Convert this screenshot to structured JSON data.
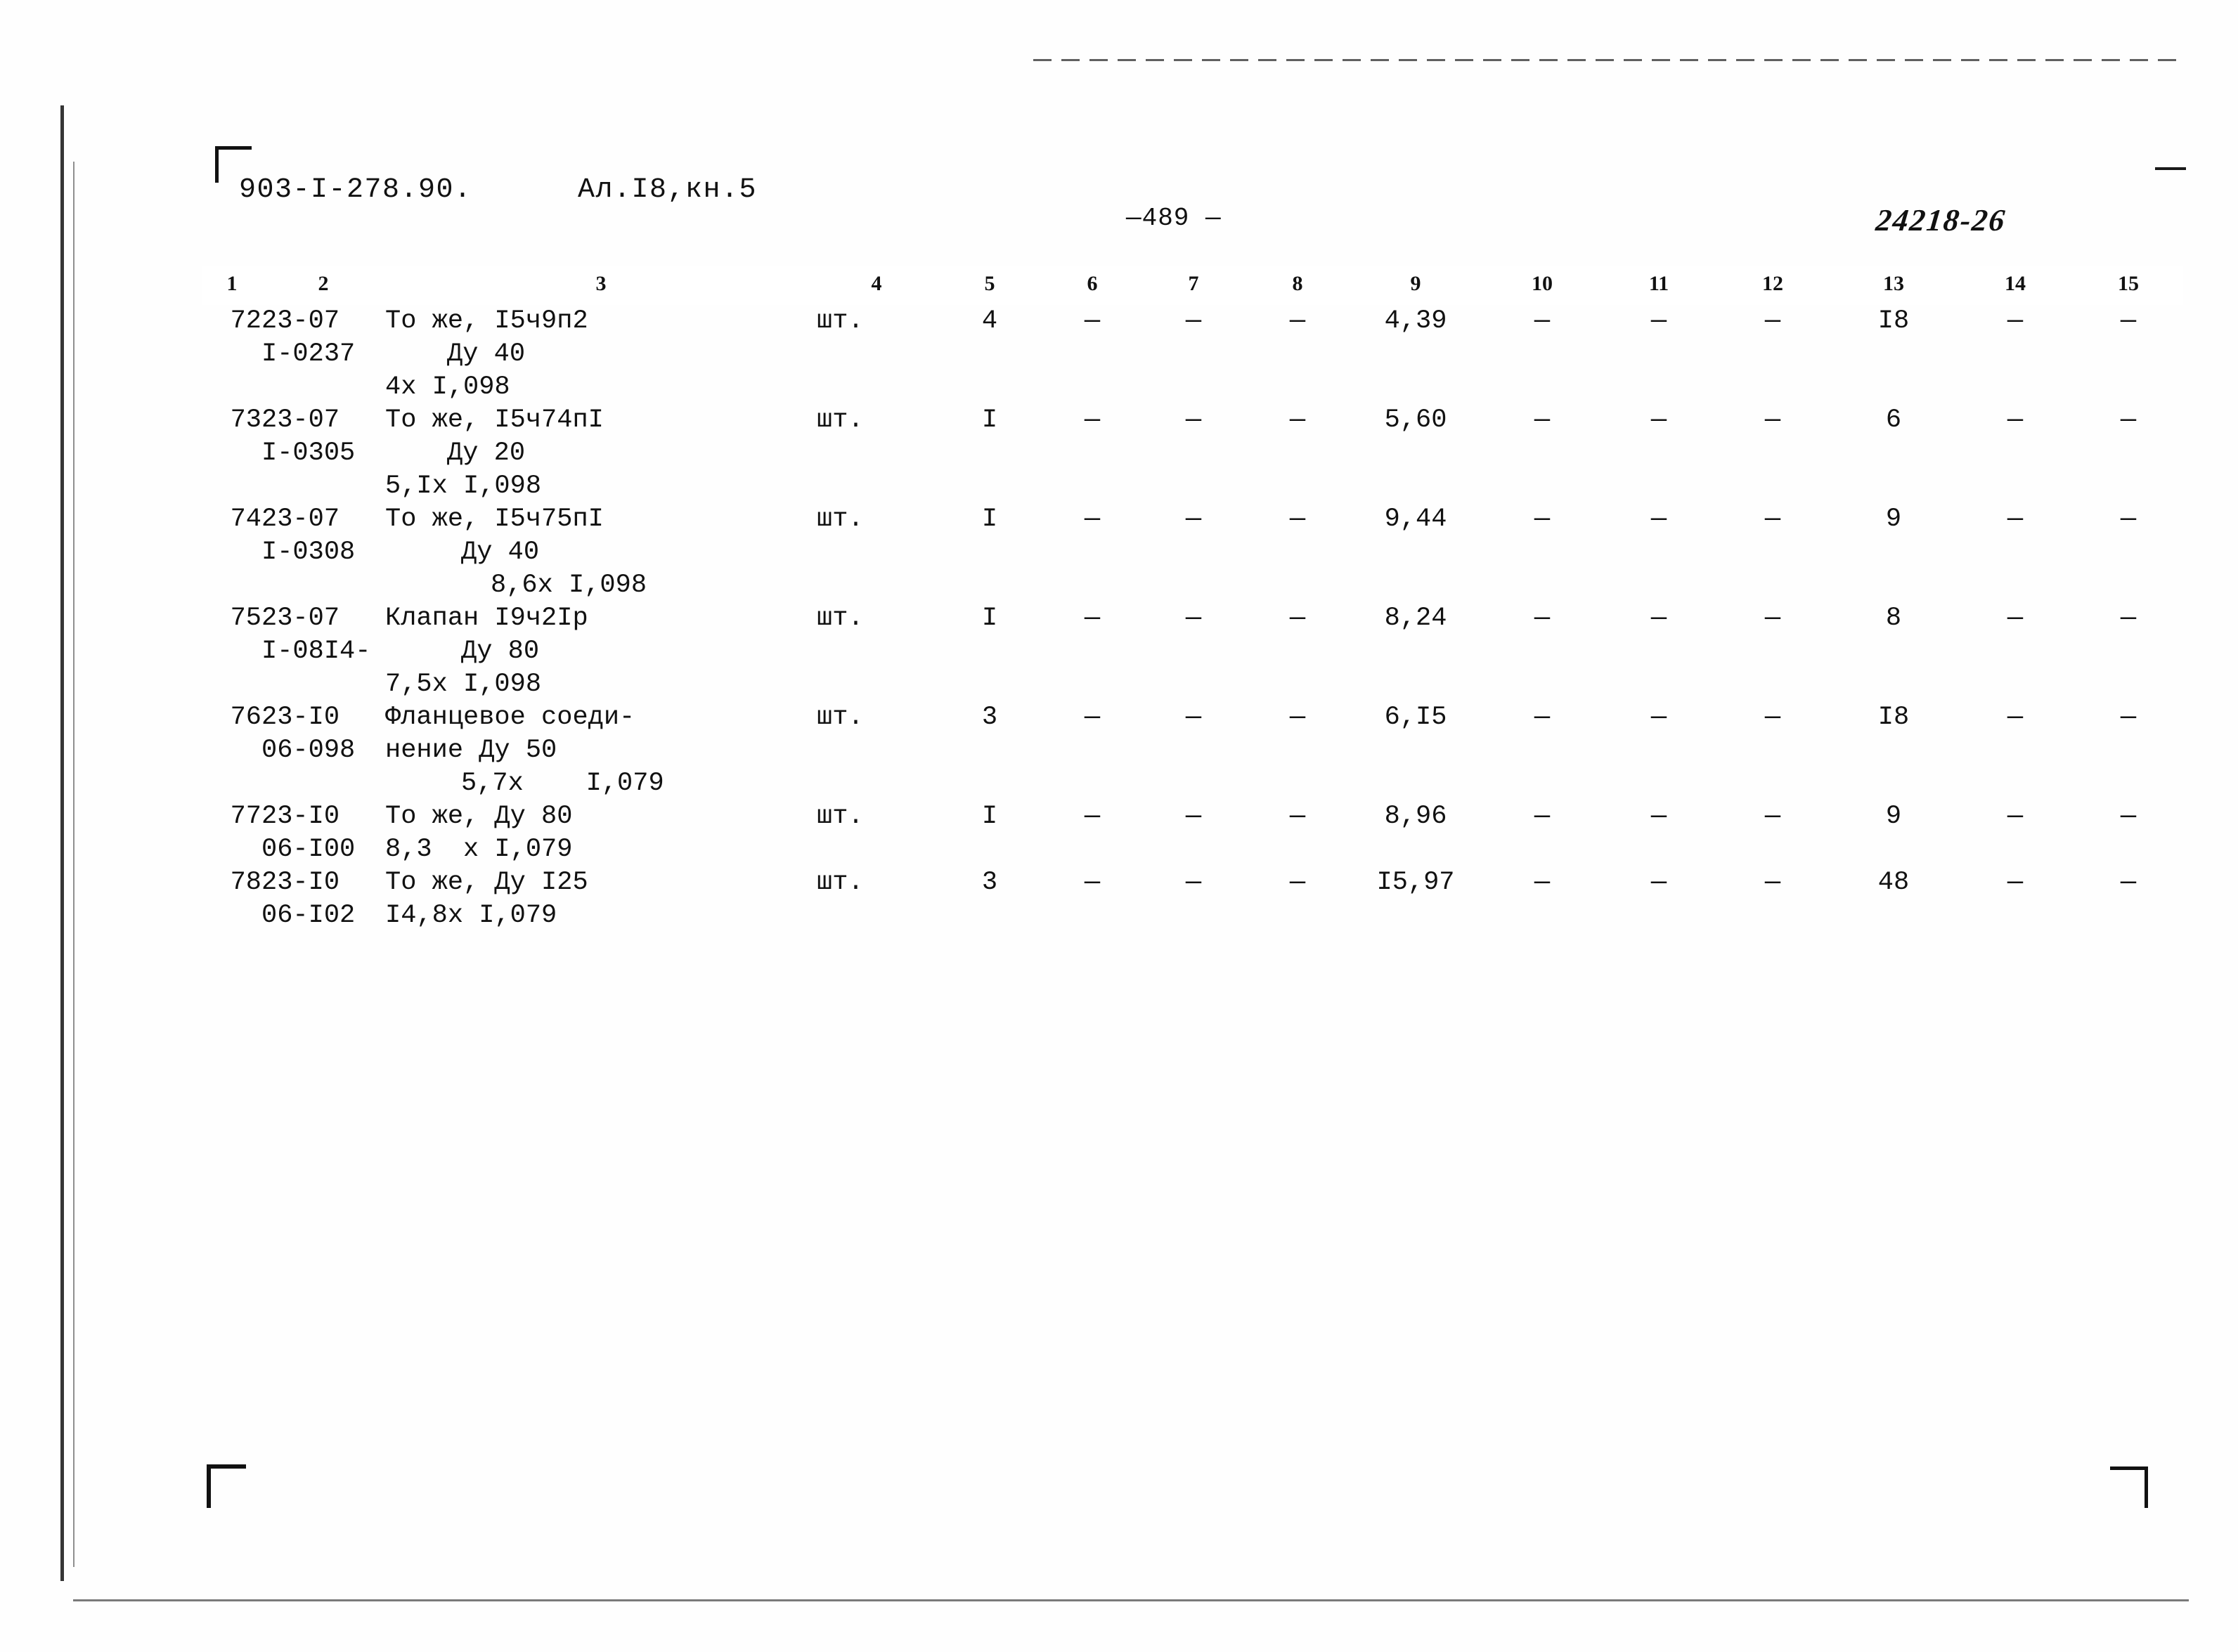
{
  "header": {
    "doc_code": "903-I-278.90.",
    "album_code": "Ал.I8,кн.5",
    "page_number": "—489 —",
    "sheet_code": "24218-26"
  },
  "table": {
    "column_headers": [
      "1",
      "2",
      "3",
      "4",
      "5",
      "6",
      "7",
      "8",
      "9",
      "10",
      "11",
      "12",
      "13",
      "14",
      "15"
    ],
    "rows": [
      {
        "num": "72",
        "code_l1": "23-07",
        "code_l2": "I-0237",
        "name_l1": "То же, I5ч9п2",
        "name_l2": "Ду 40",
        "name_l3": "4х I,098",
        "unit": "шт.",
        "c5": "4",
        "c6": "—",
        "c7": "—",
        "c8": "—",
        "c9": "4,39",
        "c10": "—",
        "c11": "—",
        "c12": "—",
        "c13": "I8",
        "c14": "—",
        "c15": "—"
      },
      {
        "num": "73",
        "code_l1": "23-07",
        "code_l2": "I-0305",
        "name_l1": "То же, I5ч74пI",
        "name_l2": "Ду 20",
        "name_l3": "5,Iх I,098",
        "unit": "шт.",
        "c5": "I",
        "c6": "—",
        "c7": "—",
        "c8": "—",
        "c9": "5,60",
        "c10": "—",
        "c11": "—",
        "c12": "—",
        "c13": "6",
        "c14": "—",
        "c15": "—"
      },
      {
        "num": "74",
        "code_l1": "23-07",
        "code_l2": "I-0308",
        "name_l1": "То же, I5ч75пI",
        "name_l2": "Ду 40",
        "name_l3": "8,6х I,098",
        "unit": "шт.",
        "c5": "I",
        "c6": "—",
        "c7": "—",
        "c8": "—",
        "c9": "9,44",
        "c10": "—",
        "c11": "—",
        "c12": "—",
        "c13": "9",
        "c14": "—",
        "c15": "—"
      },
      {
        "num": "75",
        "code_l1": "23-07",
        "code_l2": "I-08I4-",
        "name_l1": "Клапан I9ч2Iр",
        "name_l2": "Ду 80",
        "name_l3": "7,5х I,098",
        "unit": "шт.",
        "c5": "I",
        "c6": "—",
        "c7": "—",
        "c8": "—",
        "c9": "8,24",
        "c10": "—",
        "c11": "—",
        "c12": "—",
        "c13": "8",
        "c14": "—",
        "c15": "—"
      },
      {
        "num": "76",
        "code_l1": "23-I0",
        "code_l2": "06-098",
        "name_l1": "Фланцевое соеди-",
        "name_l2": "нение Ду 50",
        "name_l3": "5,7х    I,079",
        "unit": "шт.",
        "c5": "3",
        "c6": "—",
        "c7": "—",
        "c8": "—",
        "c9": "6,I5",
        "c10": "—",
        "c11": "—",
        "c12": "—",
        "c13": "I8",
        "c14": "—",
        "c15": "—"
      },
      {
        "num": "77",
        "code_l1": "23-I0",
        "code_l2": "06-I00",
        "name_l1": "То же, Ду 80",
        "name_l2": "8,3  х I,079",
        "name_l3": "",
        "unit": "шт.",
        "c5": "I",
        "c6": "—",
        "c7": "—",
        "c8": "—",
        "c9": "8,96",
        "c10": "—",
        "c11": "—",
        "c12": "—",
        "c13": "9",
        "c14": "—",
        "c15": "—"
      },
      {
        "num": "78",
        "code_l1": "23-I0",
        "code_l2": "06-I02",
        "name_l1": "То же, Ду I25",
        "name_l2": "I4,8х I,079",
        "name_l3": "",
        "unit": "шт.",
        "c5": "3",
        "c6": "—",
        "c7": "—",
        "c8": "—",
        "c9": "I5,97",
        "c10": "—",
        "c11": "—",
        "c12": "—",
        "c13": "48",
        "c14": "—",
        "c15": "—"
      }
    ]
  }
}
